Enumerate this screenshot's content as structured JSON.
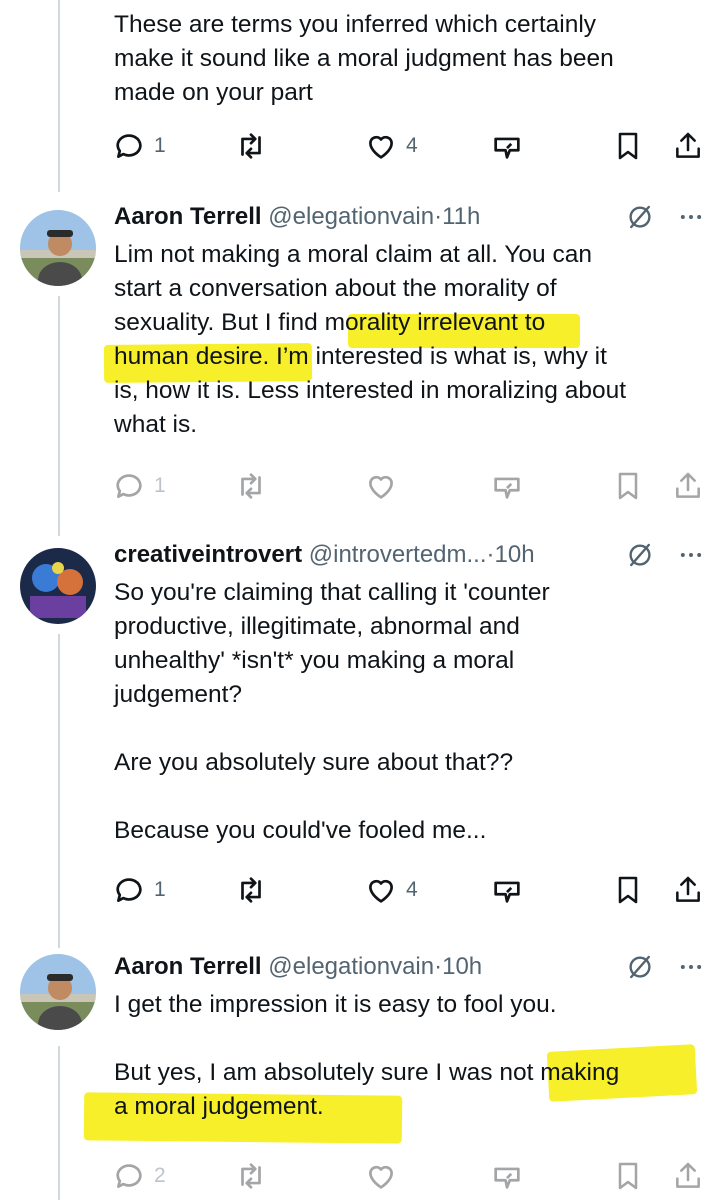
{
  "tweets": [
    {
      "text": "These are terms you inferred which certainly\nmake it sound like a moral judgment has been\nmade on your part",
      "actions": {
        "replies": "1",
        "retweets": "",
        "likes": "4"
      }
    },
    {
      "name": "Aaron Terrell",
      "handle": "@elegationvain",
      "dot": "·",
      "time": "11h",
      "text": "Lim not making a moral claim at all. You can\nstart a conversation about the morality of\nsexuality. But I find morality irrelevant to\nhuman desire. I’m interested is what is, why it\nis, how it is. Less interested in moralizing about\nwhat is.",
      "actions": {
        "replies": "1",
        "retweets": "",
        "likes": ""
      }
    },
    {
      "name": "creativeintrovert",
      "handle": "@introvertedm...",
      "dot": "·",
      "time": "10h",
      "text": "So you're claiming that calling it 'counter\nproductive, illegitimate, abnormal and\nunhealthy' *isn't* you making a moral\njudgement?\n\nAre you absolutely sure about that??\n\nBecause you could've fooled me...",
      "actions": {
        "replies": "1",
        "retweets": "",
        "likes": "4"
      }
    },
    {
      "name": "Aaron Terrell",
      "handle": "@elegationvain",
      "dot": "·",
      "time": "10h",
      "text": "I get the impression it is easy to fool you.\n\nBut yes, I am absolutely sure I was not making\na moral judgement.",
      "actions": {
        "replies": "2",
        "retweets": "",
        "likes": ""
      }
    }
  ],
  "icons": {
    "reply": "reply-icon",
    "retweet": "retweet-icon",
    "like": "heart-icon",
    "views": "grok-icon",
    "bookmark": "bookmark-icon",
    "share": "share-icon",
    "mute": "no-entry-icon",
    "more": "more-icon"
  },
  "colors": {
    "highlight": "#f7ef2a",
    "text": "#0f1419",
    "muted": "#536471",
    "thread_line": "#cfd9de"
  }
}
